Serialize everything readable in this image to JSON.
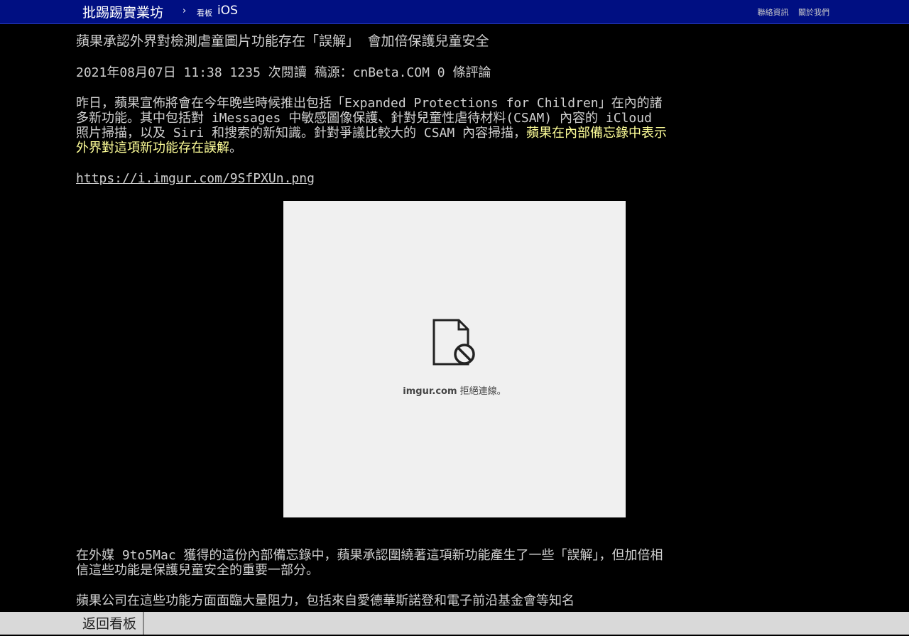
{
  "header": {
    "brand": "批踢踢實業坊",
    "separator": "›",
    "board_prefix": "看板",
    "board_name": "iOS",
    "links": [
      "聯絡資訊",
      "關於我們"
    ]
  },
  "article": {
    "title": "蘋果承認外界對檢測虐童圖片功能存在「誤解」 會加倍保護兒童安全",
    "meta": "2021年08月07日 11:38 1235 次閱讀 稿源：cnBeta.COM 0 條評論",
    "p1_text": "昨日，蘋果宣佈將會在今年晚些時候推出包括「Expanded Protections for Children」在內的諸多新功能。其中包括對 iMessages 中敏感圖像保護、針對兒童性虐待材料(CSAM) 內容的 iCloud 照片掃描，以及 Siri 和搜索的新知識。針對爭議比較大的 CSAM 內容掃描，",
    "p1_highlight": "蘋果在內部備忘錄中表示外界對這項新功能存在誤解",
    "p1_end": "。",
    "image_link": "https://i.imgur.com/9SfPXUn.png",
    "image_blocked": {
      "icon": "blocked-file-icon",
      "domain": "imgur.com",
      "message": " 拒絕連線。"
    },
    "p2": "在外媒 9to5Mac 獲得的這份內部備忘錄中，蘋果承認圍繞著這項新功能產生了一些「誤解」，但加倍相信這些功能是保護兒童安全的重要一部分。",
    "p3": "蘋果公司在這些功能方面面臨大量阻力，包括來自愛德華斯諾登和電子前沿基金會等知名"
  },
  "footer": {
    "back_label": "返回看板"
  },
  "colors": {
    "topbar": "#000f82",
    "background": "#000000",
    "text": "#cfcfcf",
    "highlight": "#ffff99",
    "bottombar": "#d9d9d9"
  }
}
